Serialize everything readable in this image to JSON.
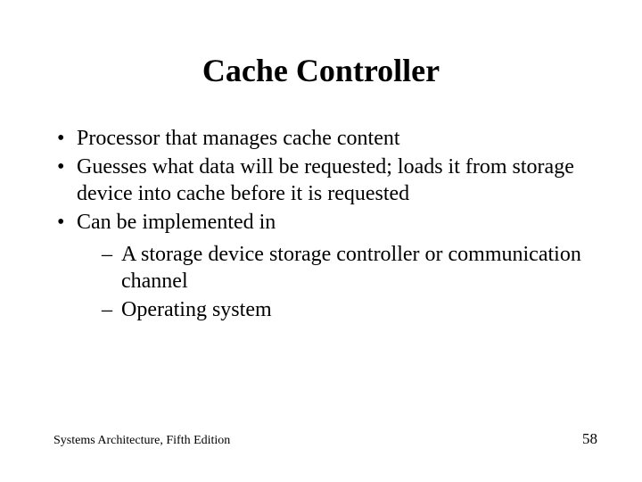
{
  "title": "Cache Controller",
  "bullets": {
    "b1": "Processor that manages cache content",
    "b2": "Guesses what data will be requested; loads it from storage device into cache before it is requested",
    "b3": "Can be implemented in"
  },
  "sub_bullets": {
    "s1": "A storage device storage controller or communication channel",
    "s2": "Operating system"
  },
  "footer": {
    "left": "Systems Architecture, Fifth Edition",
    "right": "58"
  }
}
